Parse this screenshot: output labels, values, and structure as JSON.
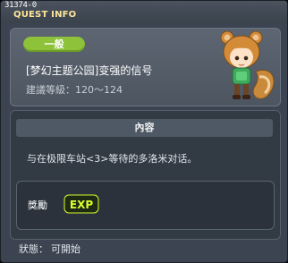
{
  "window": {
    "quest_id": "31374-0",
    "title": "QUEST INFO"
  },
  "quest": {
    "category": "一般",
    "name": "[梦幻主题公园]变强的信号",
    "level_text": "建議等級：120～124"
  },
  "content": {
    "header": "內容",
    "description": "与在极限车站<3>等待的多洛米对话。"
  },
  "reward": {
    "label": "獎勵",
    "icon": "exp-icon"
  },
  "status": {
    "label": "狀態：",
    "value": "可開始"
  },
  "colors": {
    "title": "#ffe59a",
    "badge": "#8ec23a",
    "exp": "#d6ff2c"
  }
}
